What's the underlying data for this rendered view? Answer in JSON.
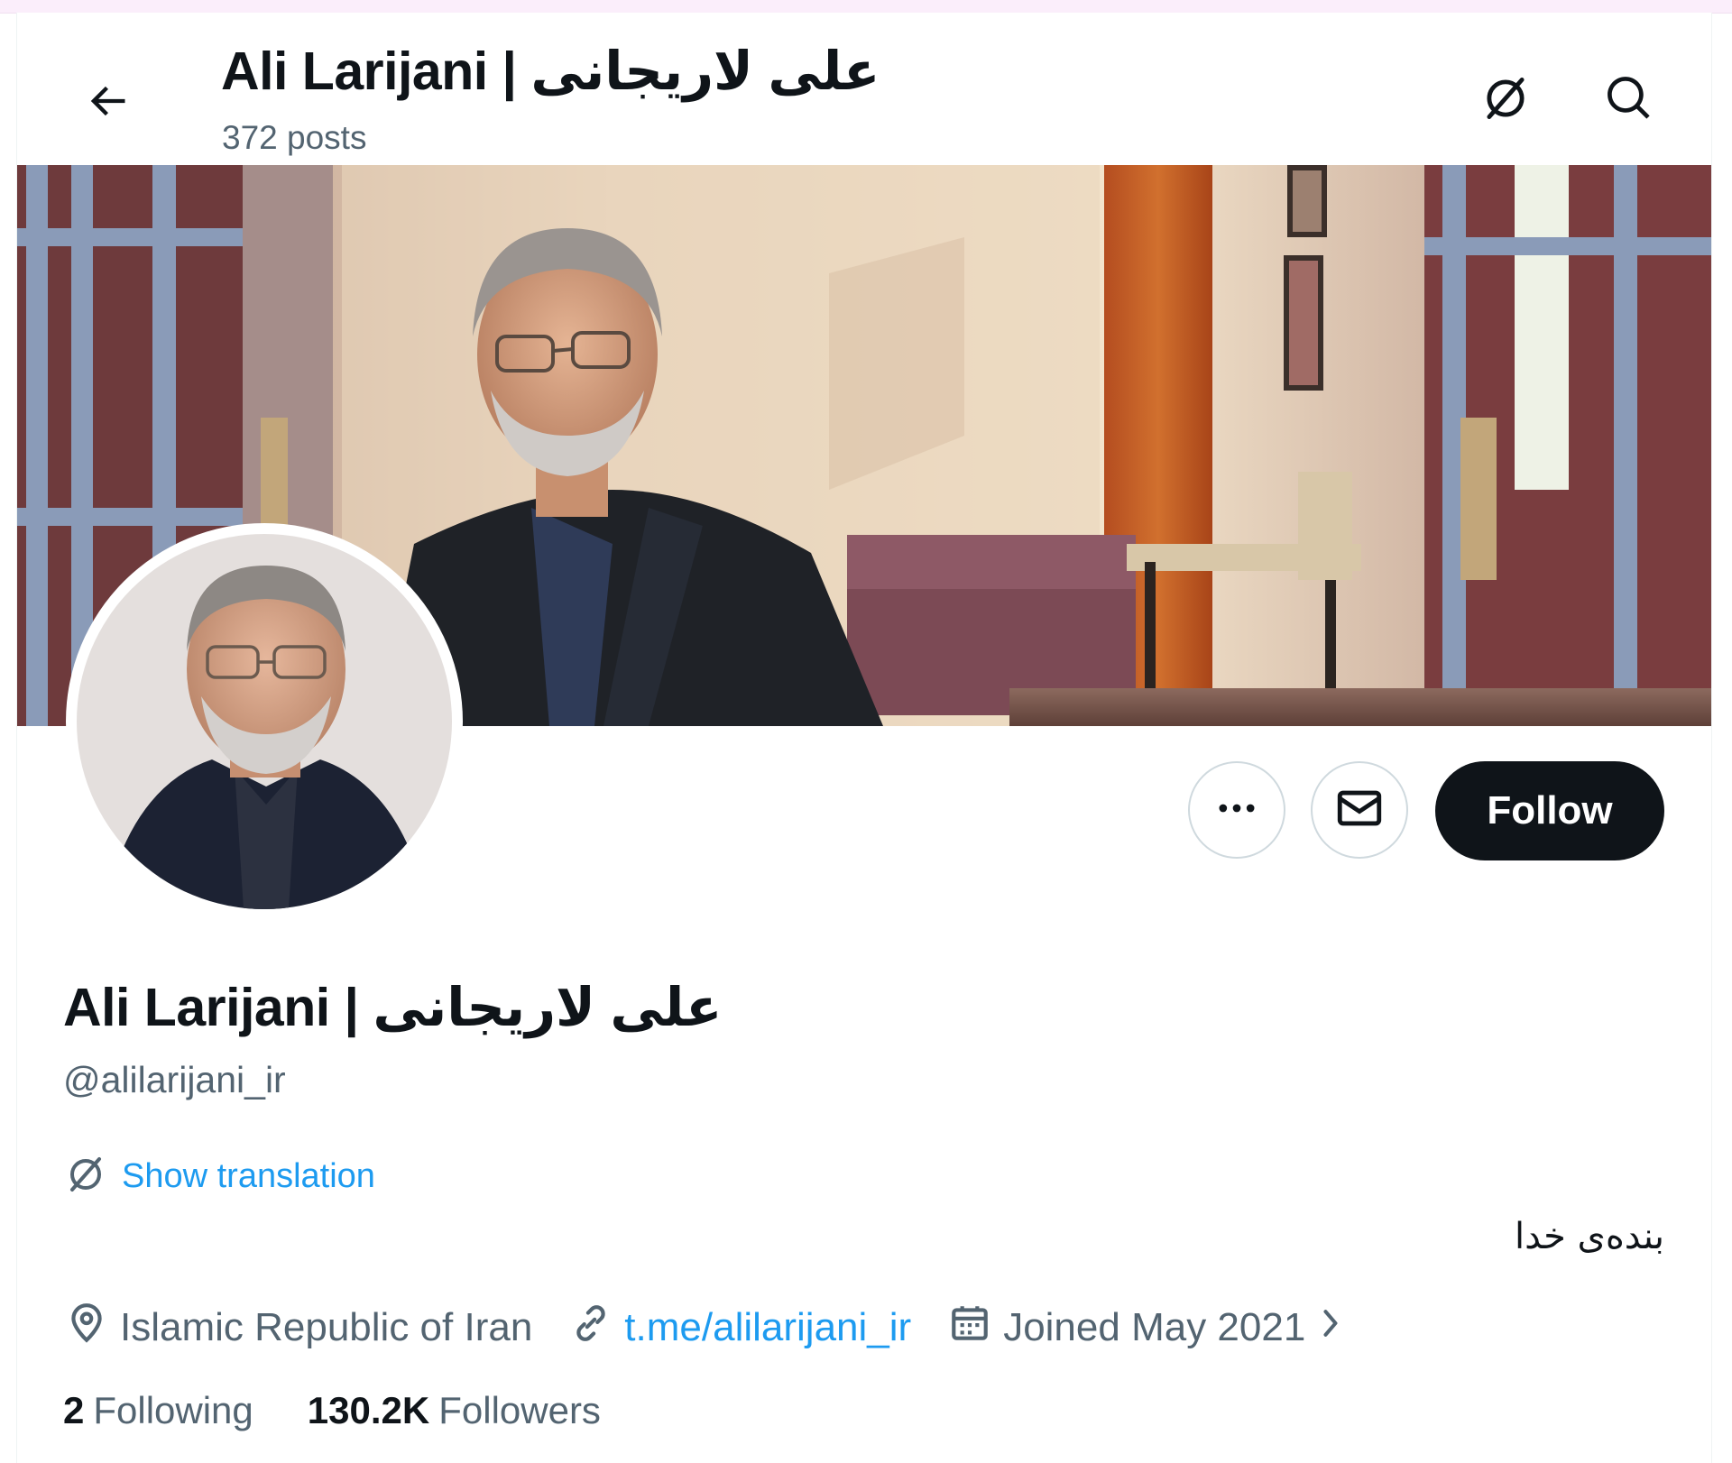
{
  "header": {
    "title": "Ali Larijani | علی لاریجانی",
    "posts_count": "372 posts",
    "back_icon": "arrow-left-icon",
    "translate_icon": "translate-icon",
    "search_icon": "search-icon"
  },
  "profile": {
    "display_name": "Ali Larijani | علی لاریجانی",
    "handle": "@alilarijani_ir",
    "show_translation": "Show translation",
    "bio": "بنده‌ی خدا",
    "location": "Islamic Republic of Iran",
    "link": "t.me/alilarijani_ir",
    "joined": "Joined May 2021",
    "following_count": "2",
    "following_label": "Following",
    "followers_count": "130.2K",
    "followers_label": "Followers"
  },
  "actions": {
    "more_icon": "more-options-icon",
    "message_icon": "envelope-icon",
    "follow_label": "Follow"
  },
  "colors": {
    "text_primary": "#0f1419",
    "text_secondary": "#536471",
    "link": "#1d9bf0",
    "follow_bg": "#0f1419",
    "border": "#cfd9de"
  }
}
